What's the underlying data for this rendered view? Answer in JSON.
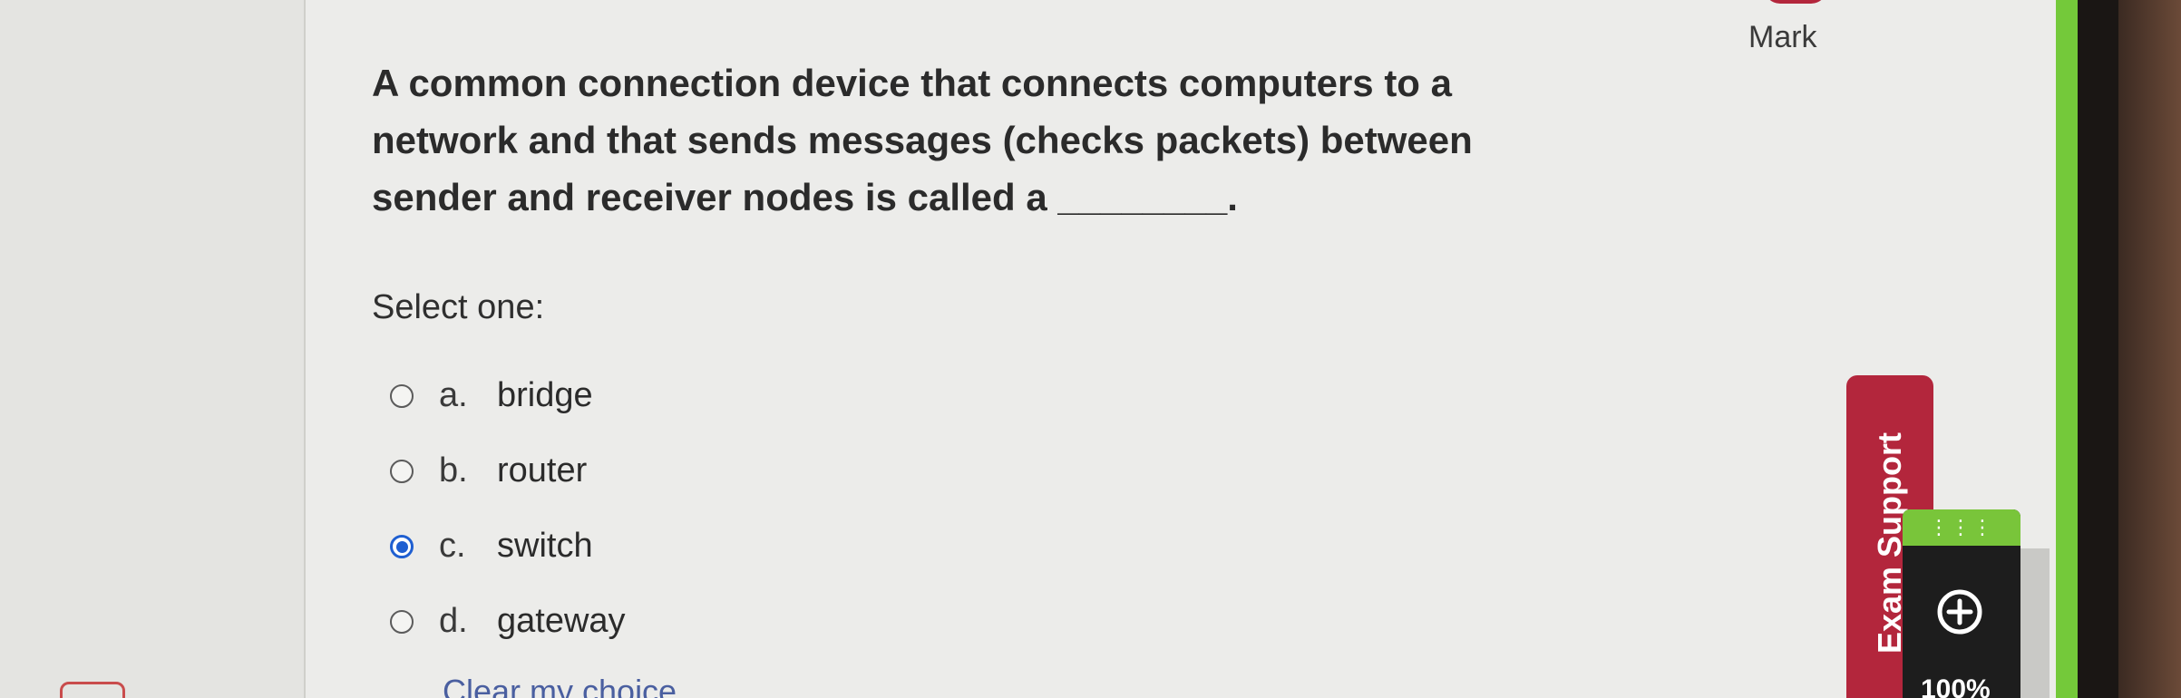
{
  "question": {
    "text": "A common connection device that connects computers to a network and that sends messages (checks packets) between sender and receiver nodes is called a ________.",
    "mark_label": "Mark",
    "prompt": "Select one:",
    "options": [
      {
        "letter": "a.",
        "text": "bridge",
        "selected": false
      },
      {
        "letter": "b.",
        "text": "router",
        "selected": false
      },
      {
        "letter": "c.",
        "text": "switch",
        "selected": true
      },
      {
        "letter": "d.",
        "text": "gateway",
        "selected": false
      }
    ],
    "clear_choice": "Clear my choice"
  },
  "exam_support": {
    "label": "Exam Support"
  },
  "zoom": {
    "level": "100%"
  },
  "colors": {
    "accent": "#1f5fd1",
    "support_red": "#b3263c",
    "widget_green": "#79c53a"
  }
}
